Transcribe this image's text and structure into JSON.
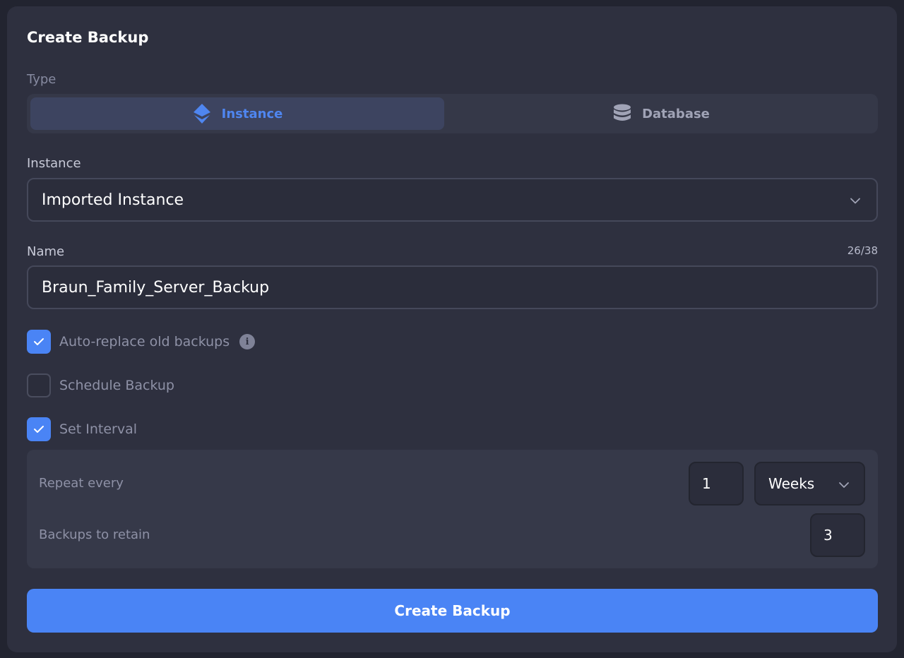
{
  "dialog": {
    "title": "Create Backup"
  },
  "type_selector": {
    "label": "Type",
    "options": [
      {
        "label": "Instance",
        "icon": "layers-icon",
        "selected": true
      },
      {
        "label": "Database",
        "icon": "database-icon",
        "selected": false
      }
    ]
  },
  "instance_select": {
    "label": "Instance",
    "value": "Imported Instance"
  },
  "name_field": {
    "label": "Name",
    "value": "Braun_Family_Server_Backup",
    "counter": "26/38"
  },
  "options": {
    "auto_replace": {
      "label": "Auto-replace old backups",
      "checked": true
    },
    "schedule": {
      "label": "Schedule Backup",
      "checked": false
    },
    "set_interval": {
      "label": "Set Interval",
      "checked": true
    }
  },
  "interval": {
    "repeat_label": "Repeat every",
    "repeat_value": "1",
    "unit_value": "Weeks",
    "retain_label": "Backups to retain",
    "retain_value": "3"
  },
  "create_button": {
    "label": "Create Backup"
  },
  "colors": {
    "accent": "#4a84f5",
    "panel": "#2e303f",
    "background": "#222430"
  }
}
